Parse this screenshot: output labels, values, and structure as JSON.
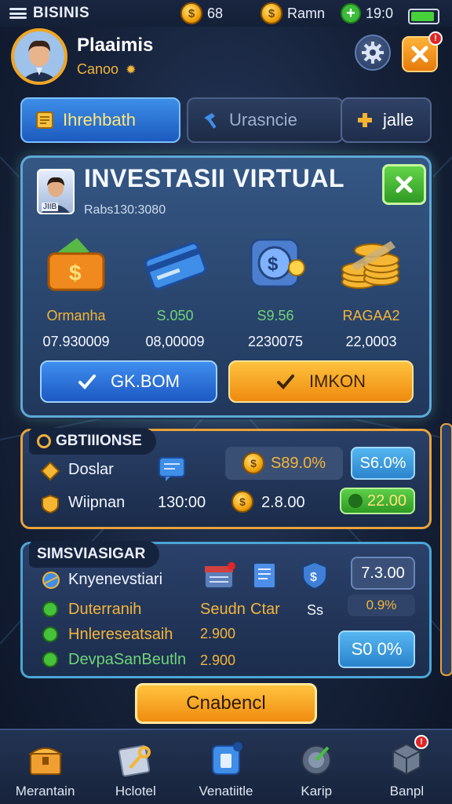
{
  "status_bar": {
    "app_title": "BISINIS",
    "currency_1": "68",
    "currency_2": "Ramn",
    "time": "19:0"
  },
  "profile": {
    "name": "Plaaimis",
    "subtitle": "Canoo"
  },
  "tabs": [
    {
      "label": "Ihrehbath"
    },
    {
      "label": "Urasncie"
    },
    {
      "label": "jalle"
    }
  ],
  "main_panel": {
    "avatar_label": "JIIB",
    "title": "INVESTASII VIRTUAL",
    "subtitle": "Rabs130:3080",
    "items": [
      {
        "label": "Ormanha",
        "value": "07.930009",
        "color": "#f3b53b"
      },
      {
        "label": "S.050",
        "value": "08,00009",
        "color": "#6fd47a"
      },
      {
        "label": "S9.56",
        "value": "2230075",
        "color": "#6fd47a"
      },
      {
        "label": "RAGAA2",
        "value": "22,0003",
        "color": "#f3b53b"
      }
    ],
    "ok_button": "GK.BOM",
    "mon_button": "IMKON"
  },
  "section1": {
    "label": "GBTIIIONSE",
    "rows": [
      {
        "name": "Doslar",
        "badge_1": "S89.0%",
        "badge_2": "S6.0%"
      },
      {
        "name": "Wiipnan",
        "value": "130:00",
        "amount": "2.8.00",
        "badge_3": "22.00"
      }
    ]
  },
  "section2": {
    "label": "SIMSVIASIGAR",
    "rows": [
      {
        "name": "Knyenevstiari"
      },
      {
        "name": "Duterranih",
        "c1": "Seudn",
        "c2": "Ctar",
        "c3": "Ss",
        "pct": "0.9%"
      },
      {
        "name": "Hnlereseatsaih",
        "amount": "2.900"
      },
      {
        "name": "DevpaSanBeutln",
        "amount": "2.900"
      }
    ],
    "value_pill": "7.3.00",
    "pct_pill": "S0 0%"
  },
  "cta_button": "Cnabencl",
  "bottom_nav": [
    {
      "label": "Merantain"
    },
    {
      "label": "Hclotel"
    },
    {
      "label": "Venatiitle"
    },
    {
      "label": "Karip"
    },
    {
      "label": "Banpl"
    }
  ],
  "colors": {
    "accent_orange": "#f0a524",
    "accent_blue": "#3d8ee8",
    "accent_green": "#46c13a",
    "panel_border": "#5ea9d4"
  }
}
